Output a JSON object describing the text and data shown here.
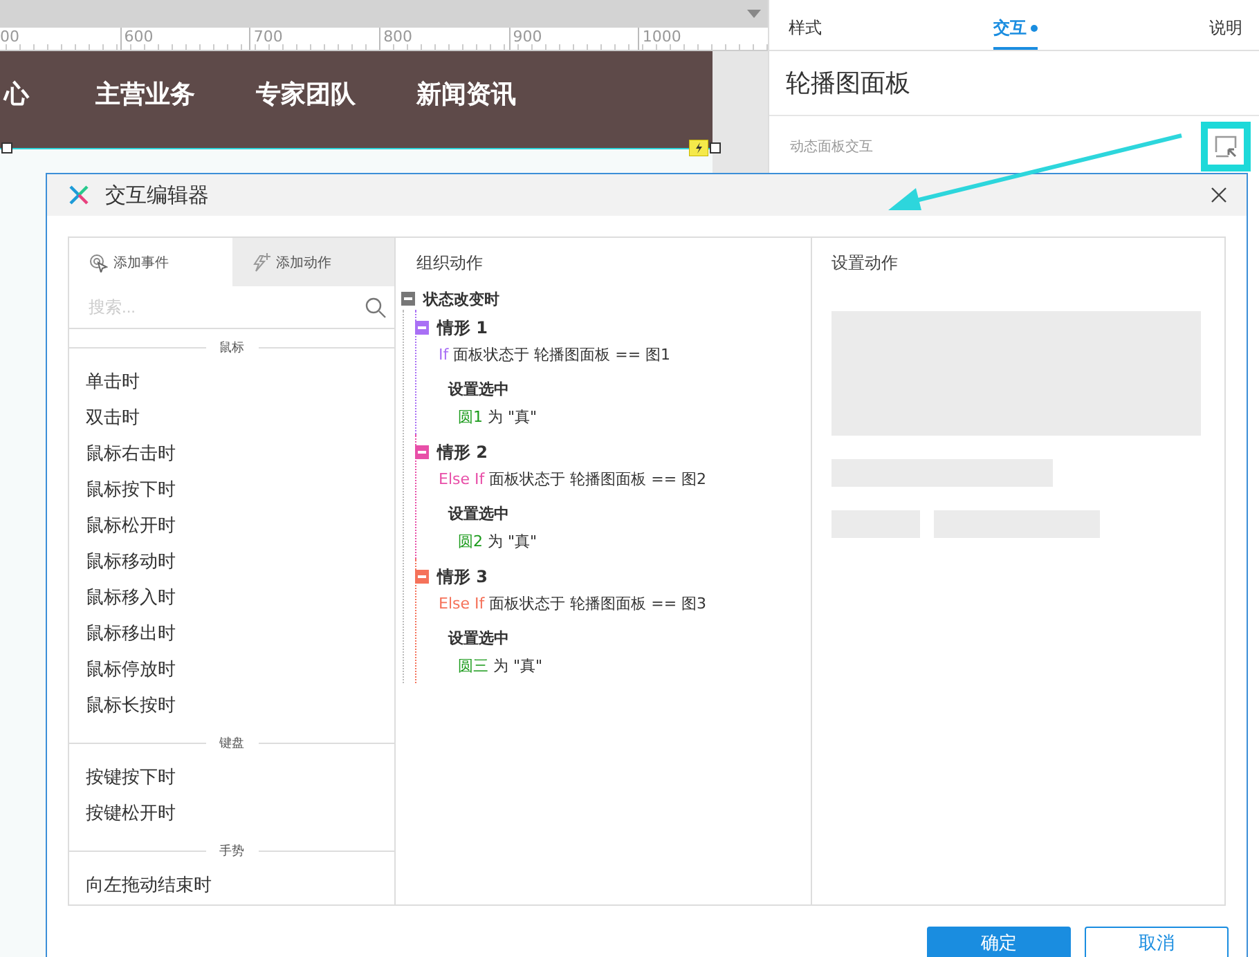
{
  "ruler": {
    "ticks": [
      "00",
      "600",
      "700",
      "800",
      "900",
      "1000"
    ]
  },
  "canvas": {
    "nav": [
      "心",
      "主营业务",
      "专家团队",
      "新闻资讯"
    ]
  },
  "inspector": {
    "tabs": [
      {
        "label": "样式",
        "selected": false,
        "dot": false
      },
      {
        "label": "交互",
        "selected": true,
        "dot": true
      },
      {
        "label": "说明",
        "selected": false,
        "dot": false
      }
    ],
    "title": "轮播图面板",
    "section": "动态面板交互"
  },
  "dialog": {
    "title": "交互编辑器",
    "tabs": [
      {
        "label": "添加事件",
        "selected": true,
        "kind": "event"
      },
      {
        "label": "添加动作",
        "selected": false,
        "kind": "action"
      }
    ],
    "search": {
      "placeholder": "搜索..."
    },
    "groups": [
      {
        "title": "鼠标",
        "items": [
          "单击时",
          "双击时",
          "鼠标右击时",
          "鼠标按下时",
          "鼠标松开时",
          "鼠标移动时",
          "鼠标移入时",
          "鼠标移出时",
          "鼠标停放时",
          "鼠标长按时"
        ]
      },
      {
        "title": "键盘",
        "items": [
          "按键按下时",
          "按键松开时"
        ]
      },
      {
        "title": "手势",
        "items": [
          "向左拖动结束时"
        ]
      }
    ],
    "organize": {
      "header": "组织动作",
      "event": "状态改变时",
      "cases": [
        {
          "title": "情形 1",
          "color": "#a970f5",
          "keyword": "If",
          "condition": "面板状态于 轮播图面板 == 图1",
          "action": "设置选中",
          "target": "圆1",
          "rest": "为 \"真\""
        },
        {
          "title": "情形 2",
          "color": "#e84fa8",
          "keyword": "Else If",
          "condition": "面板状态于 轮播图面板 == 图2",
          "action": "设置选中",
          "target": "圆2",
          "rest": "为 \"真\""
        },
        {
          "title": "情形 3",
          "color": "#f5725a",
          "keyword": "Else If",
          "condition": "面板状态于 轮播图面板 == 图3",
          "action": "设置选中",
          "target": "圆三",
          "rest": "为 \"真\""
        }
      ]
    },
    "setup": {
      "header": "设置动作"
    },
    "buttons": [
      {
        "label": "确定",
        "kind": "primary"
      },
      {
        "label": "取消",
        "kind": "secondary"
      }
    ]
  }
}
